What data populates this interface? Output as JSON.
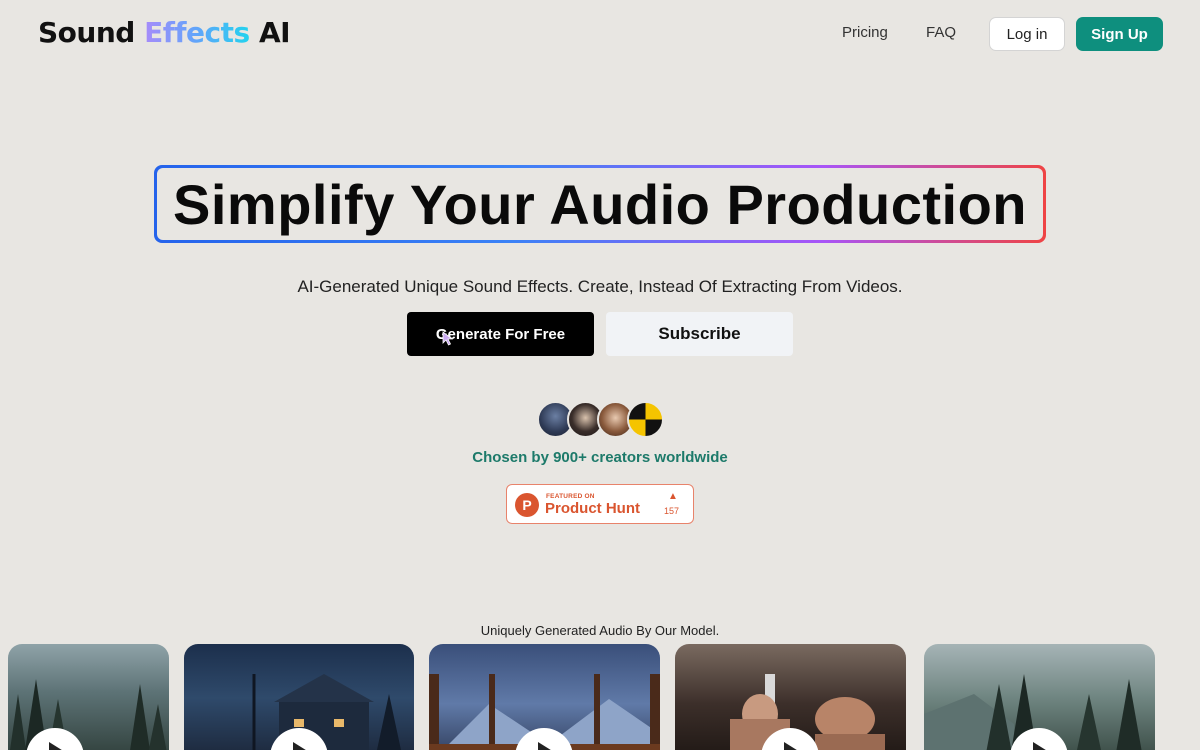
{
  "nav": {
    "logo_part1": "Sound",
    "logo_part2": "Effects",
    "logo_part3": "AI",
    "pricing": "Pricing",
    "faq": "FAQ",
    "login": "Log in",
    "signup": "Sign Up"
  },
  "hero": {
    "title": "Simplify Your Audio Production",
    "subtitle": "AI-Generated Unique Sound Effects. Create, Instead Of Extracting From Videos.",
    "generate_button": "Generate For Free",
    "subscribe_button": "Subscribe",
    "chosen_text": "Chosen by 900+ creators worldwide"
  },
  "product_hunt": {
    "featured": "FEATURED ON",
    "name": "Product Hunt",
    "logo_letter": "P",
    "arrow": "▲",
    "count": "157"
  },
  "gallery": {
    "label": "Uniquely Generated Audio By Our Model.",
    "cards": [
      "forest",
      "rainy-house",
      "snowy-window",
      "fighters",
      "forest-lake"
    ]
  },
  "colors": {
    "background": "#e8e6e2",
    "brand_teal": "#0e8f7e",
    "chosen_text": "#1d7a6a",
    "product_hunt": "#da552f"
  }
}
